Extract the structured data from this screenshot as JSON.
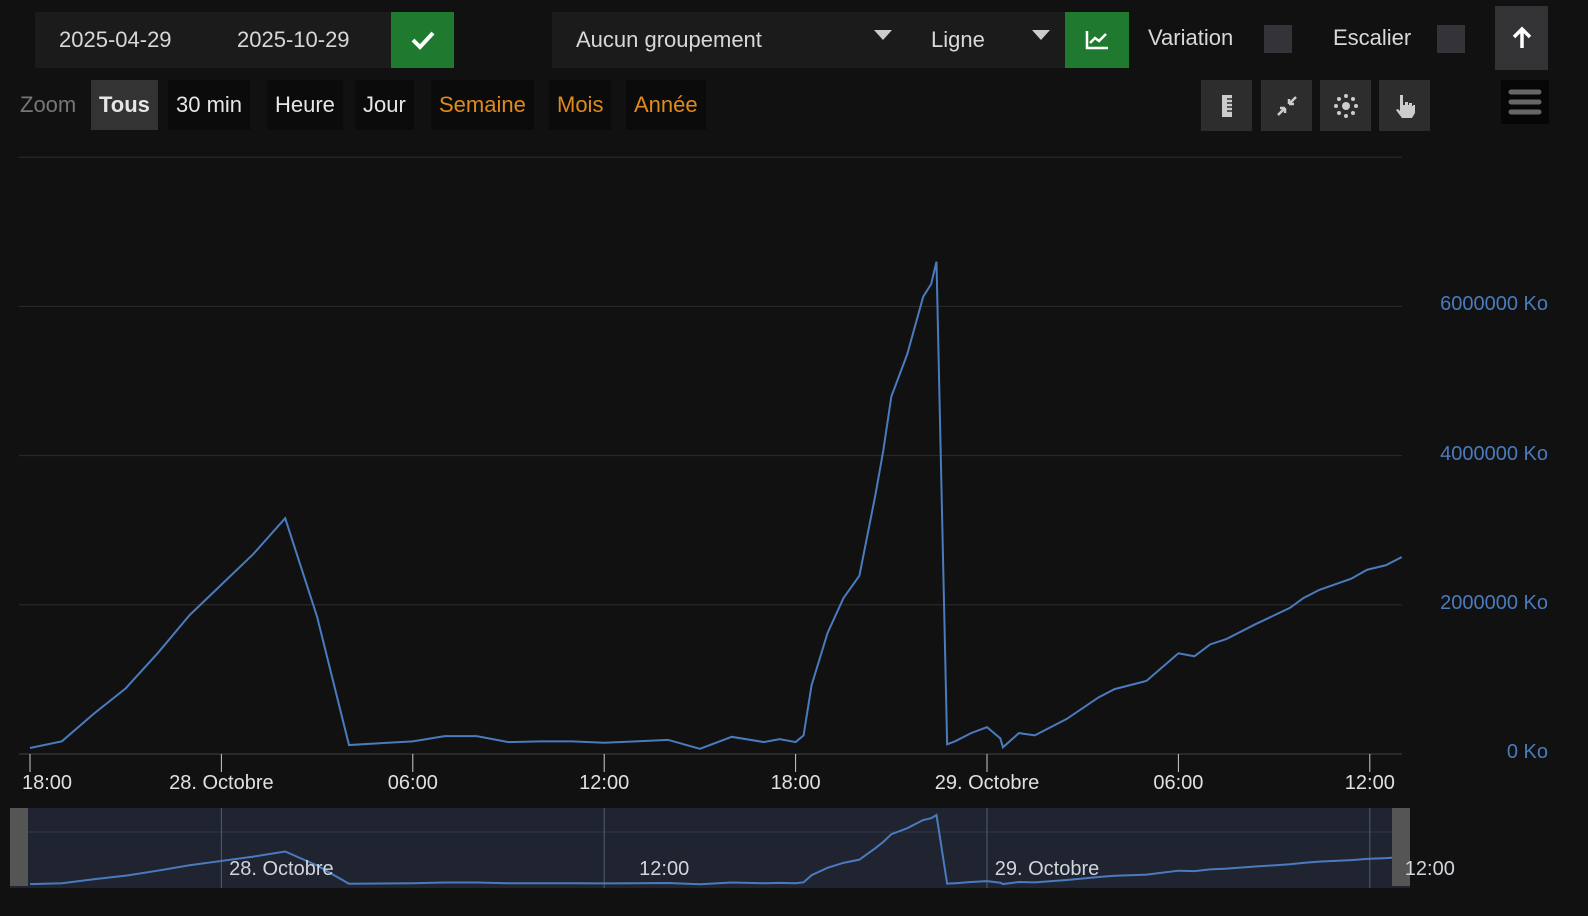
{
  "toolbar": {
    "date_from": "2025-04-29",
    "date_to": "2025-10-29",
    "grouping": "Aucun groupement",
    "chart_type": "Ligne",
    "variation_label": "Variation",
    "variation_checked": false,
    "stairs_label": "Escalier",
    "stairs_checked": false
  },
  "zoom": {
    "label": "Zoom",
    "buttons": [
      {
        "label": "Tous",
        "active": true
      },
      {
        "label": "30 min"
      },
      {
        "label": "Heure"
      },
      {
        "label": "Jour"
      },
      {
        "label": "Semaine"
      },
      {
        "label": "Mois"
      },
      {
        "label": "Année"
      }
    ]
  },
  "colors": {
    "series": "#4a7bbf",
    "accent_green": "#1f7a2f",
    "orange": "#e08a1e"
  },
  "icons": [
    "check-icon",
    "caret-down-icon",
    "line-chart-icon",
    "arrow-up-icon",
    "ruler-icon",
    "compress-icon",
    "points-icon",
    "hand-pointer-icon",
    "menu-icon"
  ],
  "chart_data": {
    "type": "line",
    "y_unit": "Ko",
    "ylim": [
      0,
      8000000
    ],
    "y_ticks": [
      "0 Ko",
      "2000000 Ko",
      "4000000 Ko",
      "6000000 Ko"
    ],
    "x_ticks": [
      "18:00",
      "28. Octobre",
      "06:00",
      "12:00",
      "18:00",
      "29. Octobre",
      "06:00",
      "12:00"
    ],
    "navigator_ticks": [
      "28. Octobre",
      "12:00",
      "29. Octobre",
      "12:00"
    ],
    "grid": true,
    "points": [
      [
        "2025-10-27 18:00",
        80000
      ],
      [
        "2025-10-27 19:00",
        170000
      ],
      [
        "2025-10-27 20:00",
        540000
      ],
      [
        "2025-10-27 21:00",
        880000
      ],
      [
        "2025-10-27 22:00",
        1350000
      ],
      [
        "2025-10-27 23:00",
        1860000
      ],
      [
        "2025-10-28 00:00",
        2270000
      ],
      [
        "2025-10-28 01:00",
        2680000
      ],
      [
        "2025-10-28 02:00",
        3160000
      ],
      [
        "2025-10-28 03:00",
        1840000
      ],
      [
        "2025-10-28 04:00",
        120000
      ],
      [
        "2025-10-28 06:00",
        170000
      ],
      [
        "2025-10-28 07:00",
        240000
      ],
      [
        "2025-10-28 08:00",
        240000
      ],
      [
        "2025-10-28 09:00",
        160000
      ],
      [
        "2025-10-28 10:00",
        170000
      ],
      [
        "2025-10-28 11:00",
        170000
      ],
      [
        "2025-10-28 12:00",
        150000
      ],
      [
        "2025-10-28 13:00",
        170000
      ],
      [
        "2025-10-28 14:00",
        190000
      ],
      [
        "2025-10-28 15:00",
        70000
      ],
      [
        "2025-10-28 16:00",
        230000
      ],
      [
        "2025-10-28 17:00",
        160000
      ],
      [
        "2025-10-28 17:30",
        200000
      ],
      [
        "2025-10-28 18:00",
        160000
      ],
      [
        "2025-10-28 18:15",
        250000
      ],
      [
        "2025-10-28 18:30",
        920000
      ],
      [
        "2025-10-28 19:00",
        1620000
      ],
      [
        "2025-10-28 19:30",
        2090000
      ],
      [
        "2025-10-28 20:00",
        2390000
      ],
      [
        "2025-10-28 20:30",
        3470000
      ],
      [
        "2025-10-28 20:45",
        4070000
      ],
      [
        "2025-10-28 21:00",
        4790000
      ],
      [
        "2025-10-28 21:30",
        5360000
      ],
      [
        "2025-10-28 22:00",
        6130000
      ],
      [
        "2025-10-28 22:15",
        6300000
      ],
      [
        "2025-10-28 22:25",
        6600000
      ],
      [
        "2025-10-28 22:45",
        130000
      ],
      [
        "2025-10-28 23:00",
        170000
      ],
      [
        "2025-10-28 23:30",
        280000
      ],
      [
        "2025-10-29 00:00",
        360000
      ],
      [
        "2025-10-29 00:25",
        210000
      ],
      [
        "2025-10-29 00:30",
        90000
      ],
      [
        "2025-10-29 01:00",
        280000
      ],
      [
        "2025-10-29 01:30",
        250000
      ],
      [
        "2025-10-29 02:30",
        470000
      ],
      [
        "2025-10-29 03:30",
        760000
      ],
      [
        "2025-10-29 04:00",
        870000
      ],
      [
        "2025-10-29 05:00",
        980000
      ],
      [
        "2025-10-29 06:00",
        1350000
      ],
      [
        "2025-10-29 06:30",
        1310000
      ],
      [
        "2025-10-29 07:00",
        1470000
      ],
      [
        "2025-10-29 07:30",
        1540000
      ],
      [
        "2025-10-29 08:25",
        1740000
      ],
      [
        "2025-10-29 09:30",
        1960000
      ],
      [
        "2025-10-29 09:55",
        2090000
      ],
      [
        "2025-10-29 10:25",
        2200000
      ],
      [
        "2025-10-29 11:25",
        2350000
      ],
      [
        "2025-10-29 11:55",
        2470000
      ],
      [
        "2025-10-29 12:30",
        2530000
      ],
      [
        "2025-10-29 13:00",
        2640000
      ]
    ]
  }
}
